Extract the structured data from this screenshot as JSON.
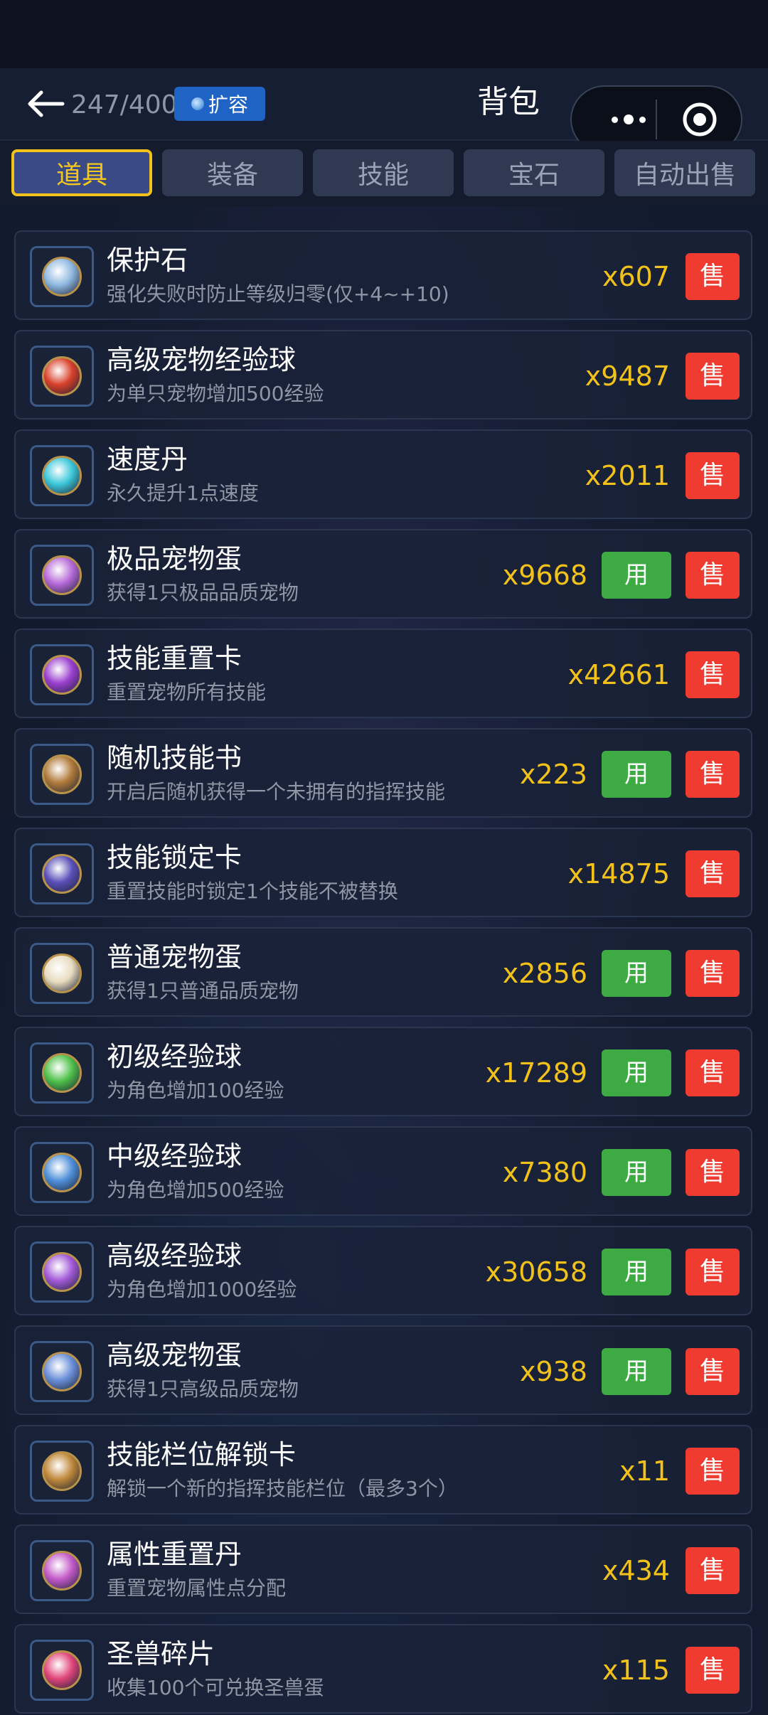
{
  "header": {
    "capacity": "247/400",
    "expand_label": "扩容",
    "title": "背包"
  },
  "tabs": [
    {
      "label": "道具",
      "active": true
    },
    {
      "label": "装备",
      "active": false
    },
    {
      "label": "技能",
      "active": false
    },
    {
      "label": "宝石",
      "active": false
    },
    {
      "label": "自动出售",
      "active": false
    }
  ],
  "buttons": {
    "use": "用",
    "sell": "售"
  },
  "colors": {
    "accent_gold": "#f3c21a",
    "use_green": "#3eaa43",
    "sell_red": "#ef3b30",
    "expand_blue": "#1f63c4"
  },
  "items": [
    {
      "name": "保护石",
      "desc": "强化失败时防止等级归零(仅+4~+10)",
      "qty": "x607",
      "usable": false,
      "icon": "protection-stone-icon",
      "color": "#8fb8e0"
    },
    {
      "name": "高级宠物经验球",
      "desc": "为单只宠物增加500经验",
      "qty": "x9487",
      "usable": false,
      "icon": "pet-exp-orb-icon",
      "color": "#d8402a"
    },
    {
      "name": "速度丹",
      "desc": "永久提升1点速度",
      "qty": "x2011",
      "usable": false,
      "icon": "speed-pill-icon",
      "color": "#3bc7d9"
    },
    {
      "name": "极品宠物蛋",
      "desc": "获得1只极品品质宠物",
      "qty": "x9668",
      "usable": true,
      "icon": "premium-pet-egg-icon",
      "color": "#b66ad8"
    },
    {
      "name": "技能重置卡",
      "desc": "重置宠物所有技能",
      "qty": "x42661",
      "usable": false,
      "icon": "skill-reset-card-icon",
      "color": "#9a3fcf"
    },
    {
      "name": "随机技能书",
      "desc": "开启后随机获得一个未拥有的指挥技能",
      "qty": "x223",
      "usable": true,
      "icon": "random-skill-book-icon",
      "color": "#b07a3a"
    },
    {
      "name": "技能锁定卡",
      "desc": "重置技能时锁定1个技能不被替换",
      "qty": "x14875",
      "usable": false,
      "icon": "skill-lock-card-icon",
      "color": "#5a4fb8"
    },
    {
      "name": "普通宠物蛋",
      "desc": "获得1只普通品质宠物",
      "qty": "x2856",
      "usable": true,
      "icon": "common-pet-egg-icon",
      "color": "#e8dcc0"
    },
    {
      "name": "初级经验球",
      "desc": "为角色增加100经验",
      "qty": "x17289",
      "usable": true,
      "icon": "basic-exp-orb-icon",
      "color": "#4fc04a"
    },
    {
      "name": "中级经验球",
      "desc": "为角色增加500经验",
      "qty": "x7380",
      "usable": true,
      "icon": "mid-exp-orb-icon",
      "color": "#4f8fd8"
    },
    {
      "name": "高级经验球",
      "desc": "为角色增加1000经验",
      "qty": "x30658",
      "usable": true,
      "icon": "advanced-exp-orb-icon",
      "color": "#a25ad8"
    },
    {
      "name": "高级宠物蛋",
      "desc": "获得1只高级品质宠物",
      "qty": "x938",
      "usable": true,
      "icon": "advanced-pet-egg-icon",
      "color": "#6a8fd8"
    },
    {
      "name": "技能栏位解锁卡",
      "desc": "解锁一个新的指挥技能栏位（最多3个）",
      "qty": "x11",
      "usable": false,
      "icon": "skill-slot-unlock-card-icon",
      "color": "#c0883a"
    },
    {
      "name": "属性重置丹",
      "desc": "重置宠物属性点分配",
      "qty": "x434",
      "usable": false,
      "icon": "attribute-reset-pill-icon",
      "color": "#c25ac8"
    },
    {
      "name": "圣兽碎片",
      "desc": "收集100个可兑换圣兽蛋",
      "qty": "x115",
      "usable": false,
      "icon": "holy-beast-fragment-icon",
      "color": "#e0457a"
    }
  ]
}
